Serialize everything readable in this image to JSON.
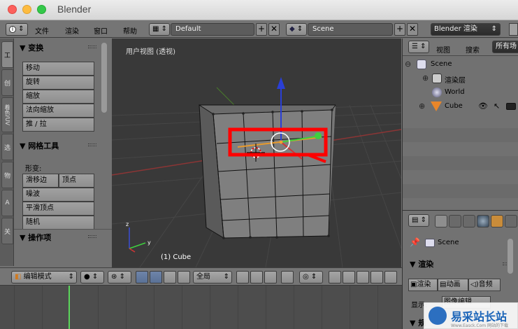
{
  "window": {
    "title": "Blender"
  },
  "info_header": {
    "menus": [
      "文件",
      "渲染",
      "窗口",
      "帮助"
    ],
    "layout": "Default",
    "scene": "Scene",
    "engine": "Blender 渲染"
  },
  "left_tabs": [
    "工",
    "创",
    "着色/UV",
    "选",
    "物",
    "A",
    "关"
  ],
  "tool_panel": {
    "transform_header": "▼ 变换",
    "transform_buttons": [
      "移动",
      "旋转",
      "缩放",
      "法向缩放",
      "推 / 拉"
    ],
    "mesh_tools_header": "▼ 网格工具",
    "deform_label": "形变:",
    "slide_edge": "滑移边",
    "slide_vertex": "顶点",
    "mesh_buttons": [
      "噪波",
      "平滑顶点",
      "随机"
    ],
    "operator_header": "▼ 操作项"
  },
  "viewport": {
    "title": "用户视图 (透视)",
    "object_label": "(1) Cube",
    "highlight_color": "#ff0000"
  },
  "outliner": {
    "view_label": "视图",
    "search_label": "搜索",
    "filter": "所有场",
    "items": [
      {
        "name": "Scene",
        "icon": "scene-icon"
      },
      {
        "name": "渲染层",
        "icon": "render-layers-icon"
      },
      {
        "name": "World",
        "icon": "world-icon"
      },
      {
        "name": "Cube",
        "icon": "mesh-icon"
      }
    ]
  },
  "properties": {
    "context_path": "Scene",
    "render_header": "▼ 渲染",
    "render_btn": "渲染",
    "animation_btn": "动画",
    "audio_btn": "音频",
    "display_label": "显示:",
    "display_value": "图像编辑",
    "next_header": "▼ 规"
  },
  "viewport_header": {
    "mode": "编辑模式",
    "orientation": "全局"
  },
  "watermark": {
    "text": "易采站长站",
    "sub": "Www.Easck.Com 网站的下载"
  }
}
